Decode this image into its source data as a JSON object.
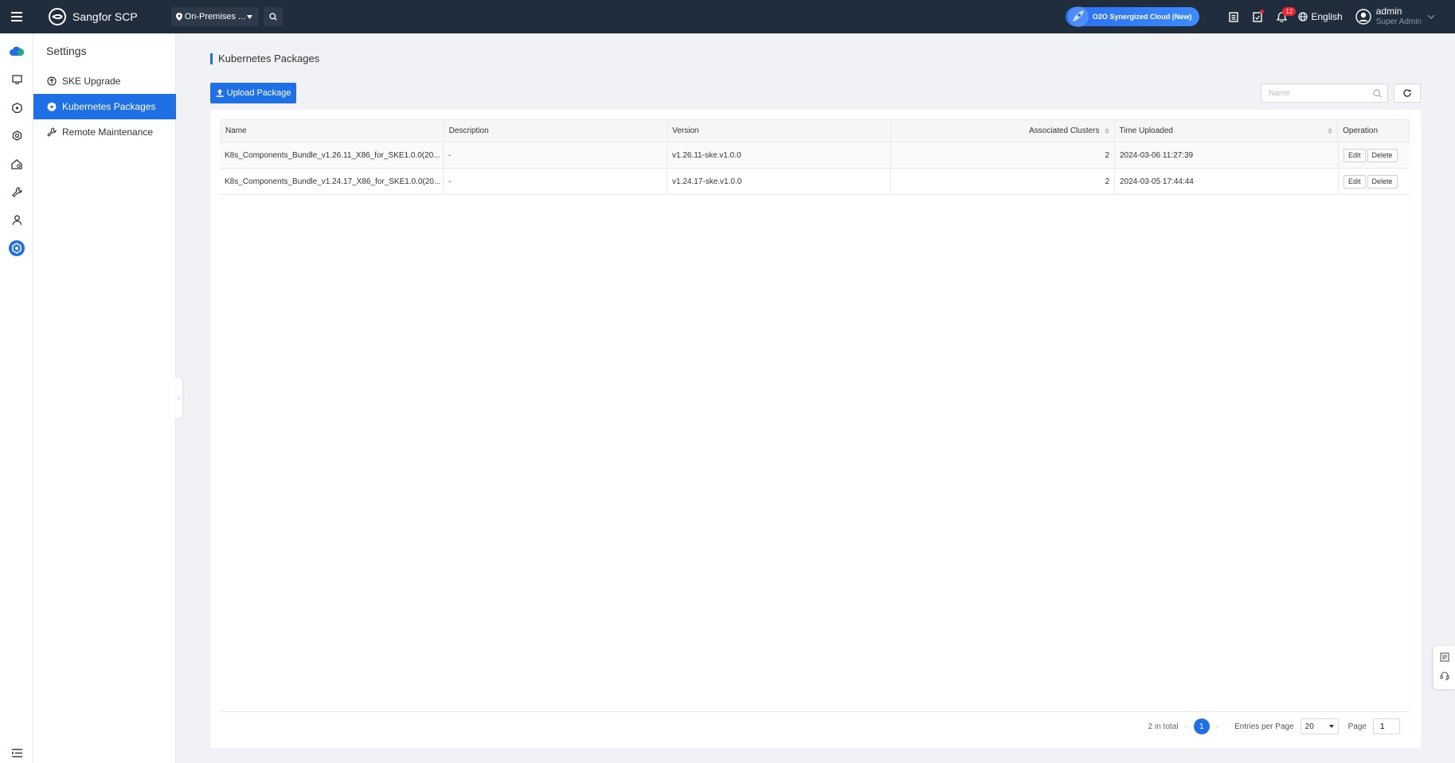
{
  "app": {
    "name": "Sangfor SCP",
    "site_selector": "On-Premises ...",
    "promo_badge": "O2O Synergized Cloud (New)",
    "notification_count": "12",
    "language": "English",
    "user": {
      "name": "admin",
      "role": "Super Admin"
    }
  },
  "subnav": {
    "title": "Settings",
    "items": [
      {
        "label": "SKE Upgrade",
        "icon": "upgrade-icon",
        "active": false
      },
      {
        "label": "Kubernetes Packages",
        "icon": "kubernetes-icon",
        "active": true
      },
      {
        "label": "Remote Maintenance",
        "icon": "wrench-icon",
        "active": false
      }
    ]
  },
  "page": {
    "title": "Kubernetes Packages",
    "upload_label": "Upload Package",
    "search_placeholder": "Name"
  },
  "table": {
    "columns": [
      "Name",
      "Description",
      "Version",
      "Associated Clusters",
      "Time Uploaded",
      "Operation"
    ],
    "rows": [
      {
        "name": "K8s_Components_Bundle_v1.26.11_X86_for_SKE1.0.0(20...",
        "description": "-",
        "version": "v1.26.11-ske.v1.0.0",
        "clusters": "2",
        "uploaded": "2024-03-06 11:27:39",
        "edit": "Edit",
        "delete": "Delete"
      },
      {
        "name": "K8s_Components_Bundle_v1.24.17_X86_for_SKE1.0.0(20...",
        "description": "-",
        "version": "v1.24.17-ske.v1.0.0",
        "clusters": "2",
        "uploaded": "2024-03-05 17:44:44",
        "edit": "Edit",
        "delete": "Delete"
      }
    ]
  },
  "pagination": {
    "total": "2 in total",
    "prev": "‹",
    "current_page": "1",
    "next": "›",
    "entries_label": "Entries per Page",
    "entries_value": "20",
    "page_label": "Page",
    "page_value": "1"
  },
  "colors": {
    "topbar": "#1f2d3d",
    "accent": "#1f6fe5",
    "badge": "#f5222d"
  }
}
